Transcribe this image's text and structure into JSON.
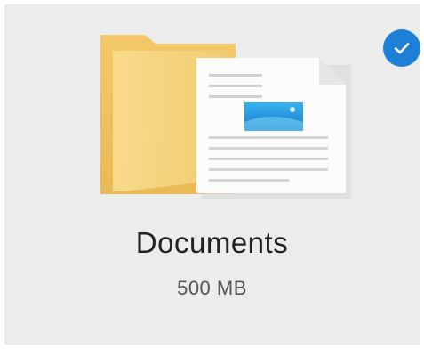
{
  "item": {
    "name": "Documents",
    "size": "500 MB",
    "selected": true,
    "icon": "documents-folder-icon",
    "selection_icon": "checkmark-icon"
  },
  "colors": {
    "tile_background": "#ececec",
    "check_badge": "#1e7fd6",
    "folder": "#f5cd6b",
    "picture_accent": "#2aa0e8"
  }
}
